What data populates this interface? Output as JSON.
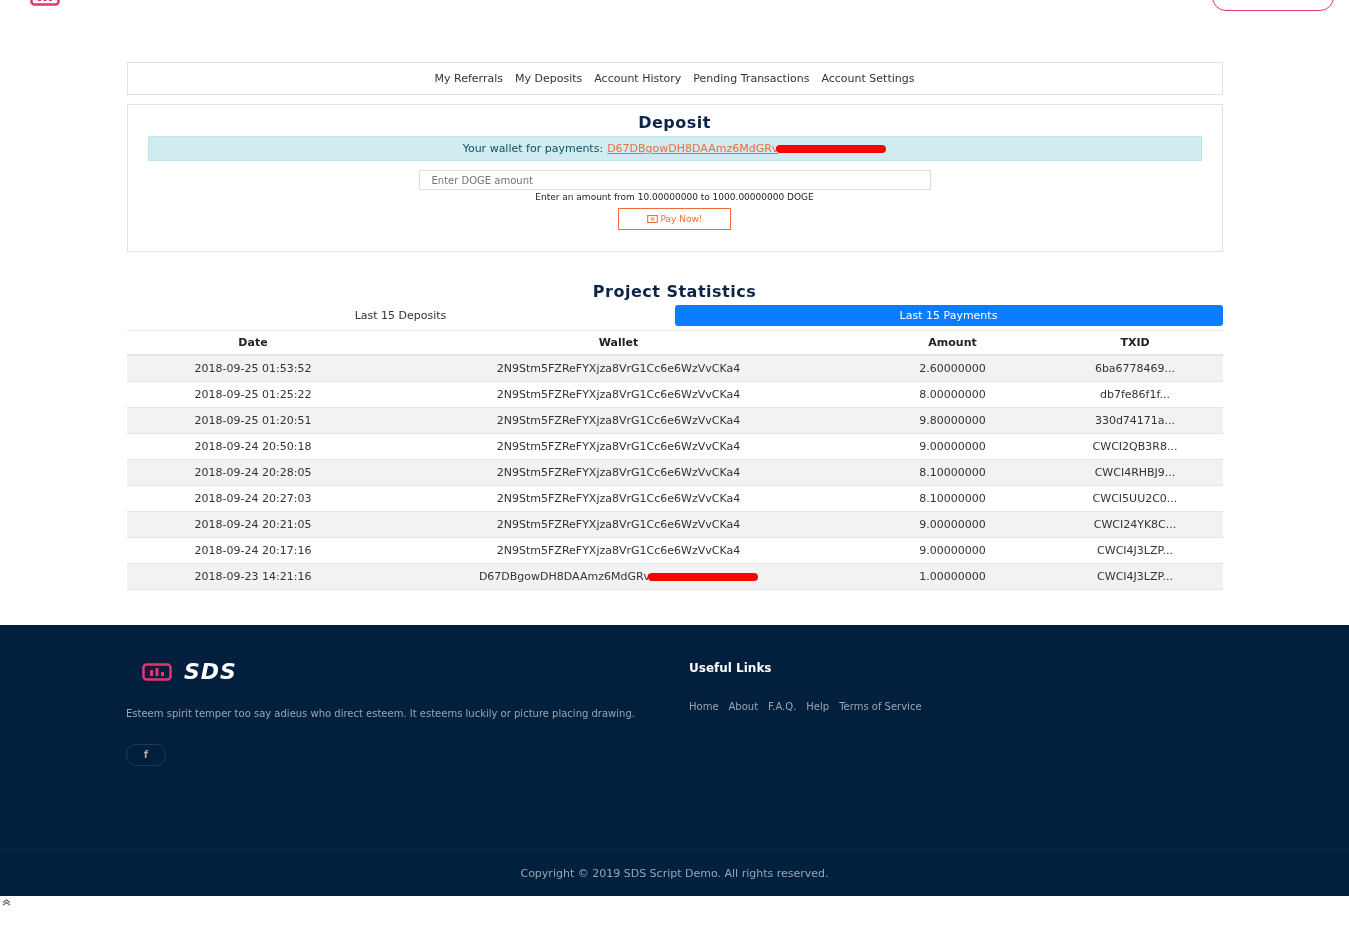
{
  "account_nav": [
    "My Referrals",
    "My Deposits",
    "Account History",
    "Pending Transactions",
    "Account Settings"
  ],
  "deposit": {
    "title": "Deposit",
    "wallet_label": "Your wallet for payments:",
    "wallet": "D67DBgowDH8DAAmz6MdGRv",
    "wallet_redacted": true,
    "amount_field": {
      "placeholder": "Enter DOGE amount"
    },
    "hint": "Enter an amount from 10.00000000 to 1000.00000000 DOGE",
    "button": "Pay Now!"
  },
  "statistics": {
    "title": "Project Statistics",
    "tabs": [
      {
        "label": "Last 15 Deposits",
        "selected": false
      },
      {
        "label": "Last 15 Payments",
        "selected": true
      }
    ],
    "columns": [
      "Date",
      "Wallet",
      "Amount",
      "TXID"
    ],
    "rows": [
      {
        "date": "2018-09-25 01:53:52",
        "wallet": "2N9Stm5FZReFYXjza8VrG1Cc6e6WzVvCKa4",
        "redacted": false,
        "amount": "2.60000000",
        "txid": "6ba6778469..."
      },
      {
        "date": "2018-09-25 01:25:22",
        "wallet": "2N9Stm5FZReFYXjza8VrG1Cc6e6WzVvCKa4",
        "redacted": false,
        "amount": "8.00000000",
        "txid": "db7fe86f1f..."
      },
      {
        "date": "2018-09-25 01:20:51",
        "wallet": "2N9Stm5FZReFYXjza8VrG1Cc6e6WzVvCKa4",
        "redacted": false,
        "amount": "9.80000000",
        "txid": "330d74171a..."
      },
      {
        "date": "2018-09-24 20:50:18",
        "wallet": "2N9Stm5FZReFYXjza8VrG1Cc6e6WzVvCKa4",
        "redacted": false,
        "amount": "9.00000000",
        "txid": "CWCI2QB3R8..."
      },
      {
        "date": "2018-09-24 20:28:05",
        "wallet": "2N9Stm5FZReFYXjza8VrG1Cc6e6WzVvCKa4",
        "redacted": false,
        "amount": "8.10000000",
        "txid": "CWCI4RHBJ9..."
      },
      {
        "date": "2018-09-24 20:27:03",
        "wallet": "2N9Stm5FZReFYXjza8VrG1Cc6e6WzVvCKa4",
        "redacted": false,
        "amount": "8.10000000",
        "txid": "CWCI5UU2C0..."
      },
      {
        "date": "2018-09-24 20:21:05",
        "wallet": "2N9Stm5FZReFYXjza8VrG1Cc6e6WzVvCKa4",
        "redacted": false,
        "amount": "9.00000000",
        "txid": "CWCI24YK8C..."
      },
      {
        "date": "2018-09-24 20:17:16",
        "wallet": "2N9Stm5FZReFYXjza8VrG1Cc6e6WzVvCKa4",
        "redacted": false,
        "amount": "9.00000000",
        "txid": "CWCI4J3LZP..."
      },
      {
        "date": "2018-09-23 14:21:16",
        "wallet": "D67DBgowDH8DAAmz6MdGRv",
        "redacted": true,
        "amount": "1.00000000",
        "txid": "CWCI4J3LZP..."
      }
    ]
  },
  "footer": {
    "brand": "SDS",
    "about": "Esteem spirit temper too say adieus who direct esteem. It esteems luckily or picture placing drawing.",
    "social": "f",
    "links_title": "Useful Links",
    "links": [
      "Home",
      "About",
      "F.A.Q.",
      "Help",
      "Terms of Service"
    ],
    "copyright": "Copyright © 2019 SDS Script Demo. All rights reserved."
  }
}
